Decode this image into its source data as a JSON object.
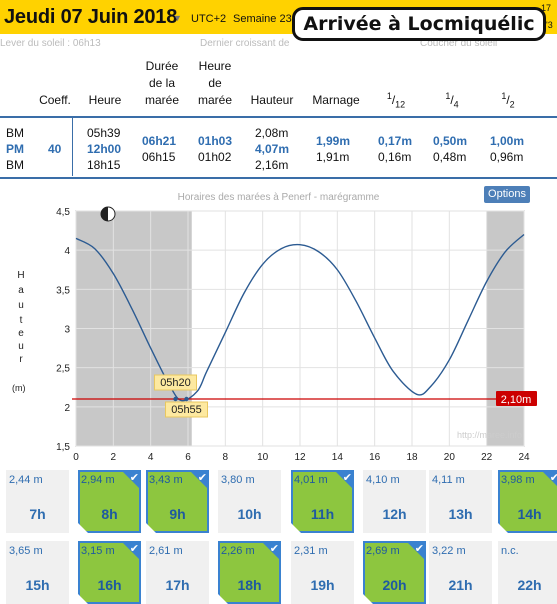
{
  "header": {
    "date": "Jeudi 07 Juin 2018",
    "utc": "UTC+2",
    "week": "Semaine 23",
    "right_top": "17",
    "right_bottom": "2'3"
  },
  "callout": "Arrivée à Locmiquélic",
  "subheader": {
    "sunrise": "Lever du soleil : 06h13",
    "last_quarter": "Dernier croissant de",
    "sunset": "Coucher du soleil"
  },
  "table": {
    "headers": [
      "Coeff.",
      "Heure",
      "Durée de la marée",
      "Heure de marée",
      "Hauteur",
      "Marnage",
      "1/12",
      "1/4",
      "1/2"
    ],
    "rows": [
      {
        "type": "BM",
        "coeff": "",
        "heure": "05h39",
        "duree": "06h21",
        "heure_maree": "01h03",
        "hauteur": "2,08m",
        "marnage": "1,99m",
        "d12": "0,17m",
        "d4": "0,50m",
        "d2": "1,00m"
      },
      {
        "type": "PM",
        "coeff": "40",
        "heure": "12h00",
        "duree": "06h15",
        "heure_maree": "01h02",
        "hauteur": "4,07m",
        "marnage": "1,91m",
        "d12": "0,16m",
        "d4": "0,48m",
        "d2": "0,96m"
      },
      {
        "type": "BM",
        "coeff": "",
        "heure": "18h15",
        "duree": "",
        "heure_maree": "",
        "hauteur": "2,16m",
        "marnage": "",
        "d12": "",
        "d4": "",
        "d2": ""
      }
    ]
  },
  "chart": {
    "title": "Horaires des marées à Penerf - marégramme",
    "options_label": "Options",
    "y_label": "Hauteur",
    "y_unit": "(m)",
    "watermark": "http://maree.info",
    "marker1": "05h20",
    "marker2": "05h55",
    "threshold_label": "2,10m",
    "colors": {
      "curve": "#2c5b92",
      "threshold": "#cc0000",
      "night": "#c8c8c8"
    }
  },
  "chart_data": {
    "type": "line",
    "title": "Horaires des marées à Penerf - marégramme",
    "xlabel": "",
    "ylabel": "Hauteur",
    "xlim": [
      0,
      24
    ],
    "ylim": [
      1.5,
      4.5
    ],
    "x_ticks": [
      "0",
      "2",
      "4",
      "6",
      "8",
      "10",
      "12",
      "14",
      "16",
      "18",
      "20",
      "22",
      "24"
    ],
    "y_ticks": [
      "1,5",
      "2",
      "2,5",
      "3",
      "3,5",
      "4",
      "4,5"
    ],
    "series": [
      {
        "name": "",
        "x": [
          0,
          1,
          2,
          3,
          4,
          5,
          5.65,
          6.5,
          7,
          8,
          9,
          10,
          11,
          12,
          13,
          14,
          15,
          16,
          17,
          18.25,
          19,
          20,
          21,
          22,
          23,
          24
        ],
        "y": [
          4.15,
          4.02,
          3.7,
          3.25,
          2.75,
          2.28,
          2.08,
          2.2,
          2.45,
          2.95,
          3.45,
          3.82,
          4.02,
          4.07,
          3.98,
          3.75,
          3.35,
          2.88,
          2.45,
          2.16,
          2.26,
          2.6,
          3.1,
          3.6,
          3.98,
          4.2
        ]
      }
    ],
    "threshold": 2.1,
    "night_ranges": [
      [
        0,
        6.2
      ],
      [
        22,
        24
      ]
    ]
  },
  "hours": [
    {
      "h": "2,44 m",
      "label": "7h",
      "selected": false
    },
    {
      "h": "2,94 m",
      "label": "8h",
      "selected": true
    },
    {
      "h": "3,43 m",
      "label": "9h",
      "selected": true
    },
    {
      "h": "3,80 m",
      "label": "10h",
      "selected": false
    },
    {
      "h": "4,01 m",
      "label": "11h",
      "selected": true
    },
    {
      "h": "4,10 m",
      "label": "12h",
      "selected": false
    },
    {
      "h": "4,11 m",
      "label": "13h",
      "selected": false
    },
    {
      "h": "3,98 m",
      "label": "14h",
      "selected": true
    },
    {
      "h": "3,65 m",
      "label": "15h",
      "selected": false
    },
    {
      "h": "3,15 m",
      "label": "16h",
      "selected": true
    },
    {
      "h": "2,61 m",
      "label": "17h",
      "selected": false
    },
    {
      "h": "2,26 m",
      "label": "18h",
      "selected": true
    },
    {
      "h": "2,31 m",
      "label": "19h",
      "selected": false
    },
    {
      "h": "2,69 m",
      "label": "20h",
      "selected": true
    },
    {
      "h": "3,22 m",
      "label": "21h",
      "selected": false
    },
    {
      "h": "n.c.",
      "label": "22h",
      "selected": false
    }
  ]
}
